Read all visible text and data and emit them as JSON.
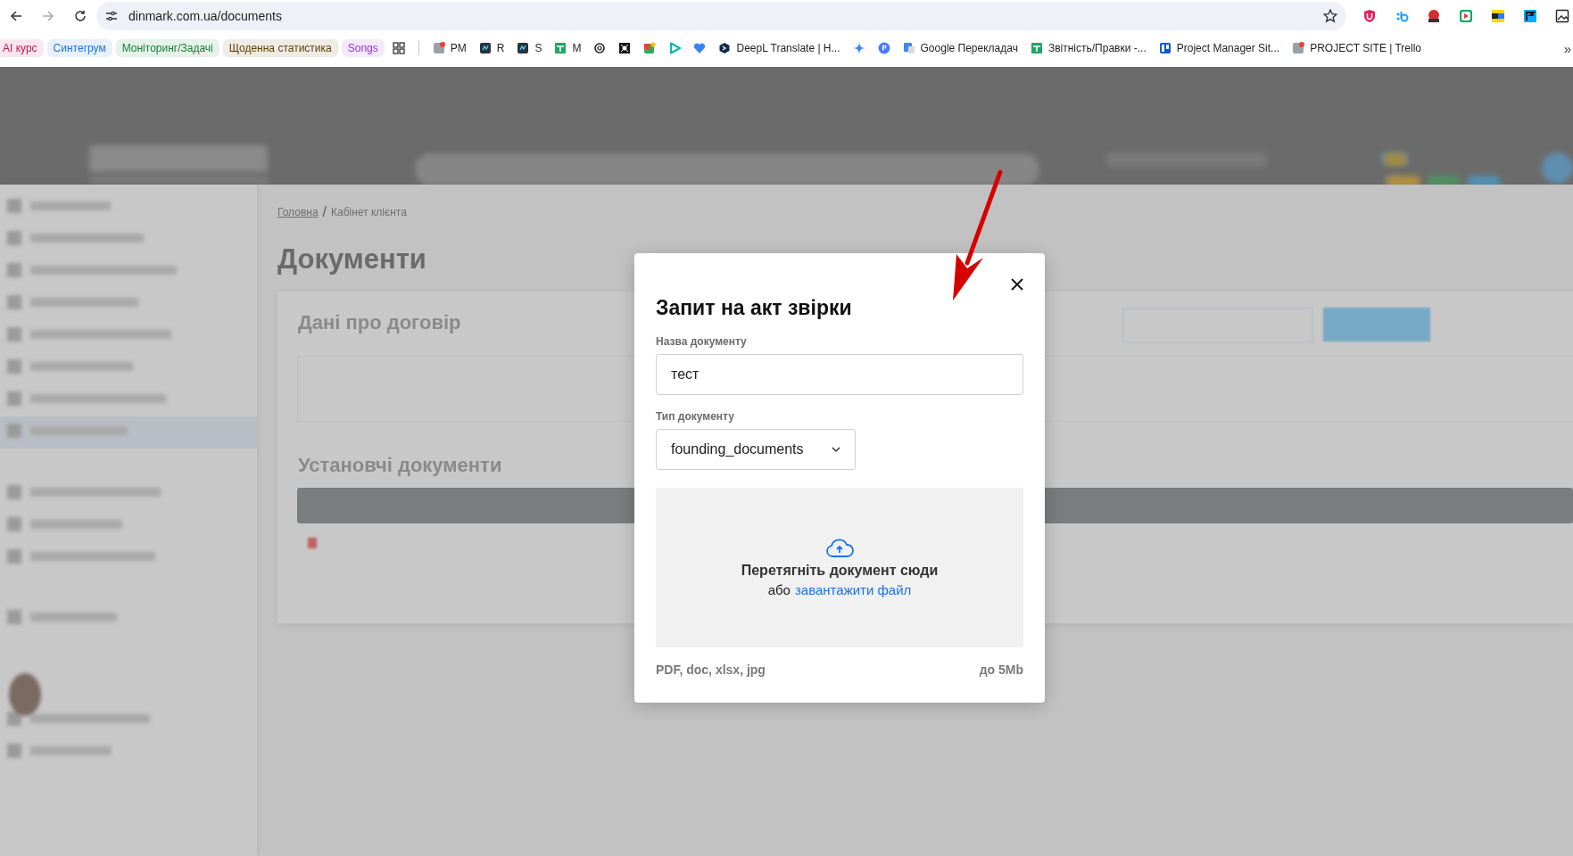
{
  "browser": {
    "url": "dinmark.com.ua/documents",
    "bookmark_groups": [
      {
        "label": "AI курс",
        "color": "#c2185b"
      },
      {
        "label": "Синтегрум",
        "color": "#1a73e8"
      },
      {
        "label": "Моніторинг/Задачі",
        "color": "#188038"
      },
      {
        "label": "Щоденна статистика",
        "color": "#5f4100"
      },
      {
        "label": "Songs",
        "color": "#9334e6"
      }
    ],
    "bookmarks": [
      {
        "label": "PM"
      },
      {
        "label": "R"
      },
      {
        "label": "S"
      },
      {
        "label": "M"
      },
      {
        "label": "DeepL Translate | H..."
      },
      {
        "label": "Google Перекладач"
      },
      {
        "label": "Звітність/Правки -..."
      },
      {
        "label": "Project Manager Sit..."
      },
      {
        "label": "PROJECT SITE | Trello"
      }
    ],
    "more": "»"
  },
  "page": {
    "breadcrumb": [
      {
        "label": "Головна",
        "link": true
      },
      {
        "label": "Кабінет клієнта",
        "link": false
      }
    ],
    "separator": "/",
    "title": "Документи",
    "sections": [
      "Дані про договір",
      "Установчі документи"
    ]
  },
  "modal": {
    "title": "Запит на акт звірки",
    "fields": [
      {
        "kind": "text",
        "label": "Назва документу",
        "value": "тест"
      },
      {
        "kind": "select",
        "label": "Тип документу",
        "value": "founding_documents"
      }
    ],
    "dropzone": {
      "text": "Перетягніть документ сюди",
      "prefix": "або",
      "link": "завантажити файл"
    },
    "formats": "PDF, doc, xlsx, jpg",
    "max_size": "до 5Mb"
  }
}
